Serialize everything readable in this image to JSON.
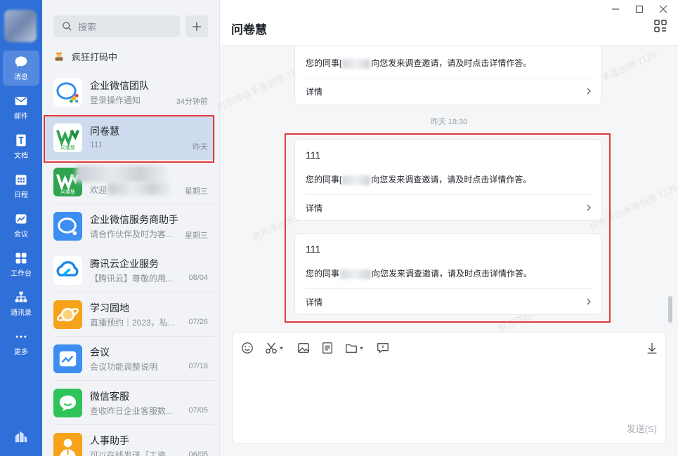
{
  "nav": {
    "items": [
      {
        "label": "消息",
        "icon": "chat-icon"
      },
      {
        "label": "邮件",
        "icon": "mail-icon"
      },
      {
        "label": "文档",
        "icon": "doc-icon"
      },
      {
        "label": "日程",
        "icon": "calendar-icon"
      },
      {
        "label": "会议",
        "icon": "meeting-icon"
      },
      {
        "label": "工作台",
        "icon": "workbench-icon"
      },
      {
        "label": "通讯录",
        "icon": "contacts-icon"
      },
      {
        "label": "更多",
        "icon": "more-icon"
      }
    ]
  },
  "sidebar": {
    "search_placeholder": "搜索",
    "status_text": "疯狂打码中",
    "conversations": [
      {
        "name": "企业微信团队",
        "preview": "登录操作通知",
        "time": "34分钟前",
        "icon": "wecom-team-icon"
      },
      {
        "name": "问卷慧",
        "preview": "111",
        "time": "昨天",
        "icon": "wenjuanhui-icon"
      },
      {
        "name": "",
        "preview": "欢迎",
        "time": "星期三",
        "icon": "wenjuanhui-icon"
      },
      {
        "name": "企业微信服务商助手",
        "preview": "请合作伙伴及时为客...",
        "time": "星期三",
        "icon": "wecom-provider-icon"
      },
      {
        "name": "腾讯云企业服务",
        "preview": "【腾讯云】尊敬的用...",
        "time": "08/04",
        "icon": "tencent-cloud-icon"
      },
      {
        "name": "学习园地",
        "preview": "直播预约｜2023，私...",
        "time": "07/26",
        "icon": "planet-icon"
      },
      {
        "name": "会议",
        "preview": "会议功能调整说明",
        "time": "07/18",
        "icon": "meeting-app-icon"
      },
      {
        "name": "微信客服",
        "preview": "查收昨日企业客服数...",
        "time": "07/05",
        "icon": "wechat-service-icon"
      },
      {
        "name": "人事助手",
        "preview": "可以在线发送［工资...",
        "time": "06/05",
        "icon": "hr-assistant-icon"
      }
    ]
  },
  "chat": {
    "title": "问卷慧",
    "timestamp": "昨天 18:30",
    "top_card": {
      "text_prefix": "您的同事[",
      "text_suffix": "向您发来调查邀请，请及时点击详情作答。",
      "detail": "详情"
    },
    "cards": [
      {
        "title": "111",
        "text_prefix": "您的同事[",
        "text_suffix": "向您发来调查邀请，请及时点击详情作答。",
        "detail": "详情"
      },
      {
        "title": "111",
        "text_prefix": "您的同事",
        "text_suffix": "向您发来调查邀请，请及时点击详情作答。",
        "detail": "详情"
      }
    ],
    "send_label": "发送(S)",
    "watermark_text": "何东洋@禾苗创想 7125"
  },
  "colors": {
    "rail": "#2f6fd8",
    "highlight_box": "#e23b3b",
    "selected_row": "#cfdcef"
  }
}
